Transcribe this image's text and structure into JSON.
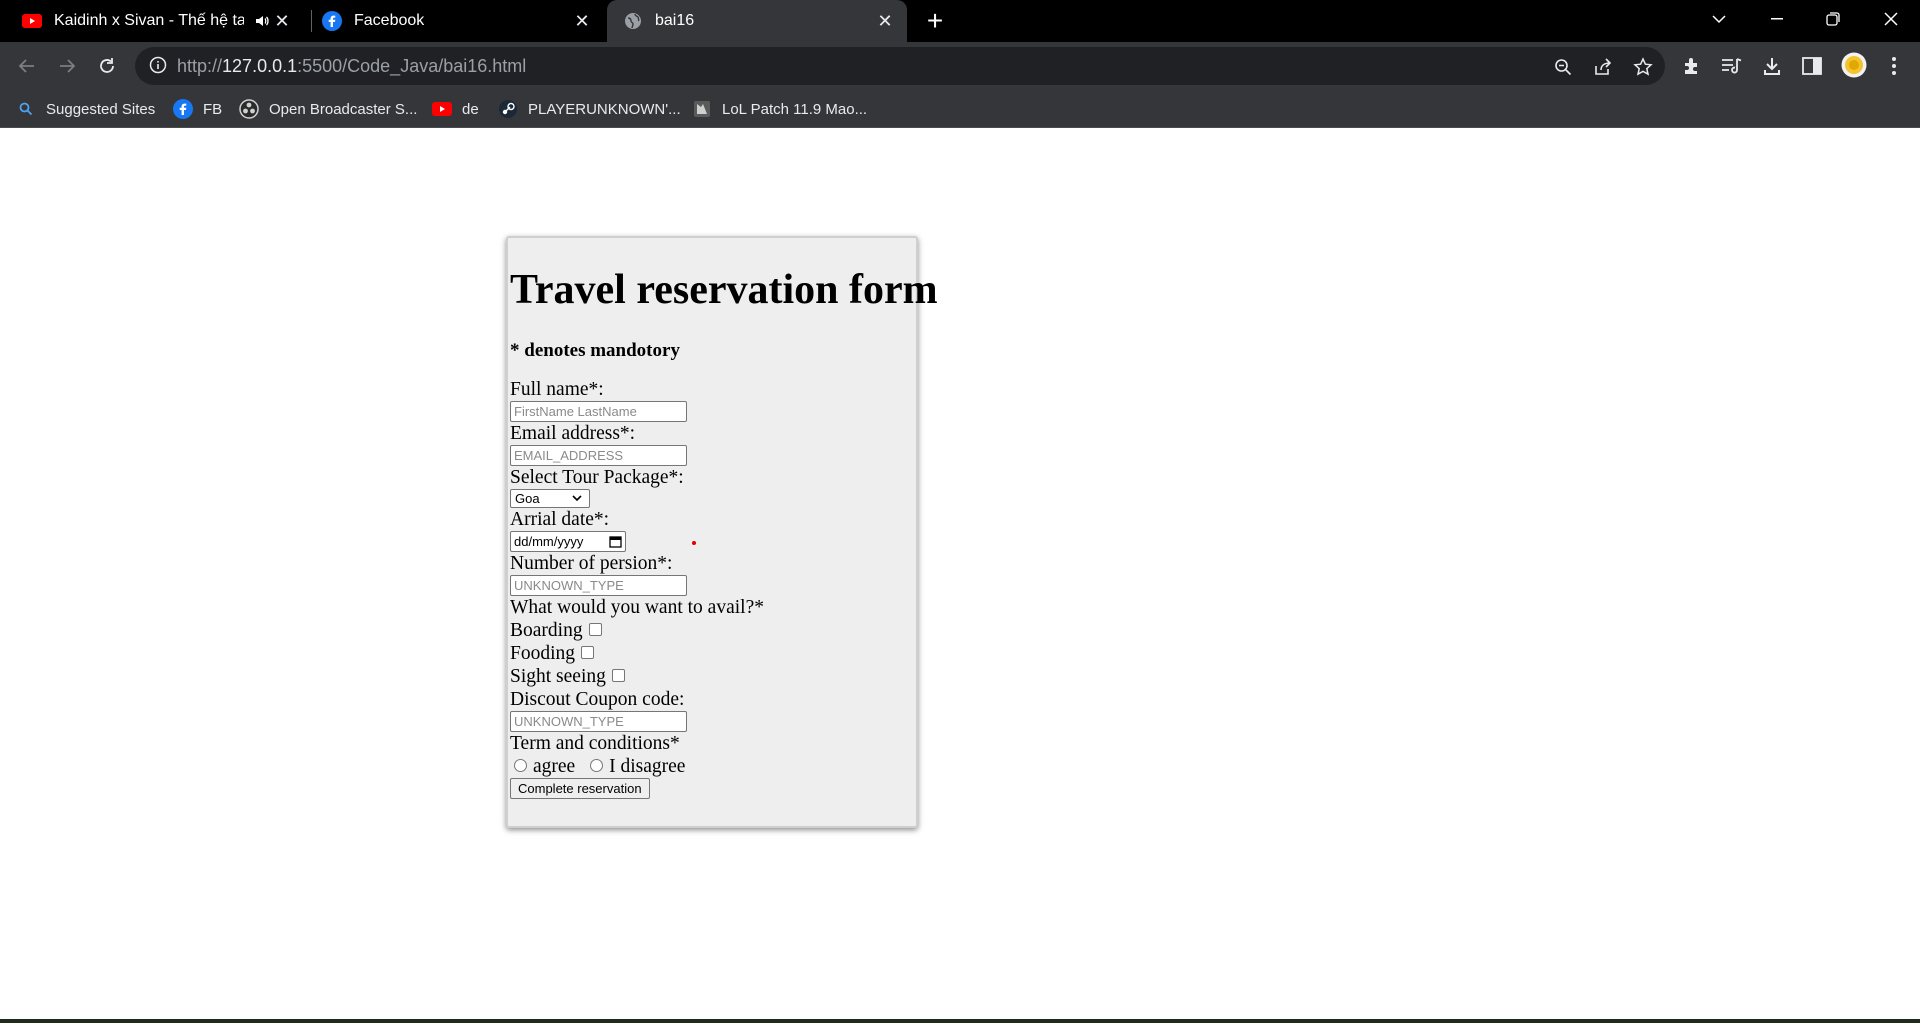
{
  "tabs": [
    {
      "title": "Kaidinh x Sivan - Thế hệ tan v",
      "icon": "youtube-icon",
      "audio": true
    },
    {
      "title": "Facebook",
      "icon": "facebook-icon"
    },
    {
      "title": "bai16",
      "icon": "globe-icon",
      "active": true
    }
  ],
  "address": {
    "scheme": "http://",
    "host": "127.0.0.1",
    "rest": ":5500/Code_Java/bai16.html"
  },
  "bookmarks": [
    {
      "label": "Suggested Sites",
      "icon": "search-icon"
    },
    {
      "label": "FB",
      "icon": "facebook-icon"
    },
    {
      "label": "Open Broadcaster S...",
      "icon": "obs-icon"
    },
    {
      "label": "de",
      "icon": "youtube-icon"
    },
    {
      "label": "PLAYERUNKNOWN'...",
      "icon": "steam-icon"
    },
    {
      "label": "LoL Patch 11.9 Mao...",
      "icon": "lol-icon"
    }
  ],
  "form": {
    "title": "Travel reservation form",
    "note": "* denotes mandotory",
    "full_name_label": "Full name*:",
    "full_name_placeholder": "FirstName LastName",
    "email_label": "Email address*:",
    "email_placeholder": "EMAIL_ADDRESS",
    "package_label": "Select Tour Package*:",
    "package_value": "Goa",
    "date_label": "Arrial date*:",
    "date_value": "dd/mm/yyyy",
    "persons_label": "Number of persion*:",
    "persons_placeholder": "UNKNOWN_TYPE",
    "avail_label": "What would you want to avail?*",
    "options": [
      "Boarding",
      "Fooding",
      "Sight seeing"
    ],
    "coupon_label": "Discout Coupon code:",
    "coupon_placeholder": "UNKNOWN_TYPE",
    "terms_label": "Term and conditions*",
    "terms_agree": "agree",
    "terms_disagree": "I disagree",
    "submit_label": "Complete reservation"
  },
  "colors": {
    "accent_dot": "#e00000",
    "chrome_dark": "#35363a",
    "form_bg": "#eeeeee"
  }
}
